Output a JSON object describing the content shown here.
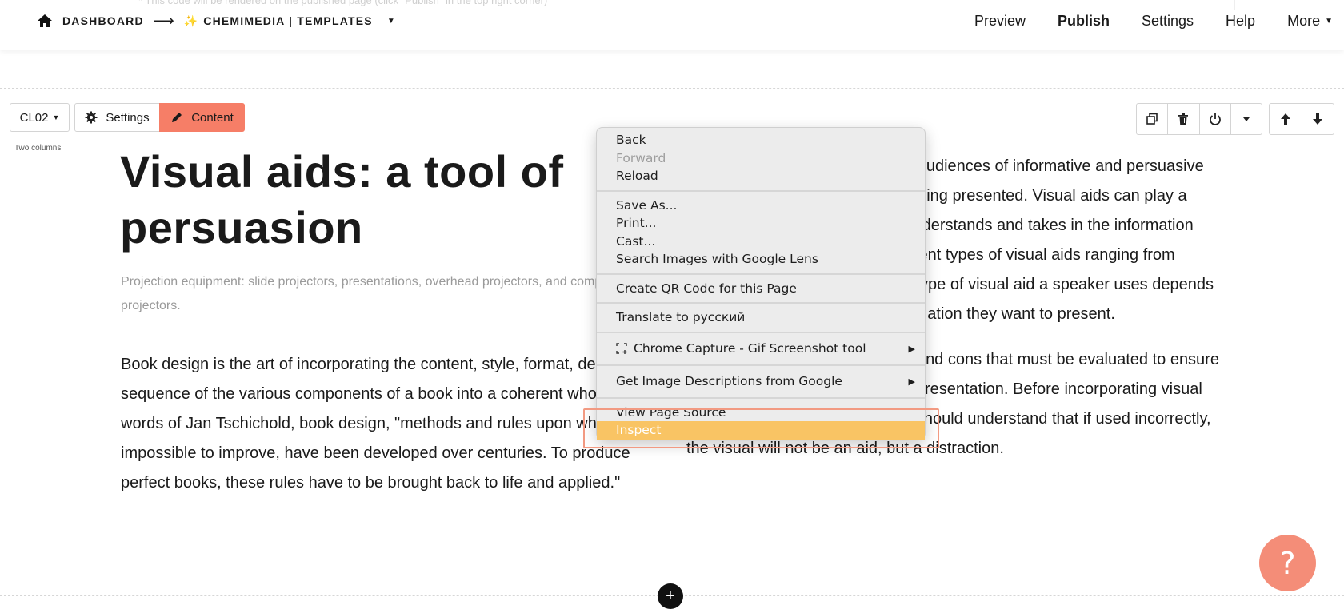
{
  "header": {
    "notice": "* This code will be rendered on the published page (click \"Publish\" in the top right corner)",
    "breadcrumb": {
      "home_icon": "home-icon",
      "dashboard": "DASHBOARD",
      "arrow": "⟶",
      "sparkle": "✨",
      "project": "CHEMIMEDIA | TEMPLATES",
      "caret": "▼"
    },
    "nav": {
      "preview": "Preview",
      "publish": "Publish",
      "settings": "Settings",
      "help": "Help",
      "more": "More"
    }
  },
  "toolbar": {
    "layout_select": "CL02",
    "settings_label": "Settings",
    "content_label": "Content",
    "layout_caption": "Two columns",
    "right_icons": [
      "duplicate-icon",
      "trash-icon",
      "power-icon",
      "caret-down-icon",
      "arrow-up-icon",
      "arrow-down-icon"
    ]
  },
  "content": {
    "title": "Visual aids: a tool of persuasion",
    "caption": "Projection equipment: slide projectors, presentations, overhead projectors, and computer projectors.",
    "left_body": "Book design is the art of incorporating the content, style, format, design, and sequence of the various components of a book into a coherent whole. In the words of Jan Tschichold, book design, \"methods and rules upon which it is impossible to improve, have been developed over centuries. To produce perfect books, these rules have to be brought back to life and applied.\"",
    "right_body_1": "Visual aids are designed to help audiences of informative and persuasive speeches understand the topic being presented. Visual aids can play a large role in how the audience understands and takes in the information presented. There are many different types of visual aids ranging from handouts to presenataions. The type of visual aid a speaker uses depends on their preference and the information they want to present.",
    "right_body_2": "Each type of visual aid has pros and cons that must be evaluated to ensure it will be beneficial to the overall presentation. Before incorporating visual aids into speeches, the speaker should understand that if used incorrectly, the visual will not be an aid, but a distraction."
  },
  "context_menu": {
    "back": "Back",
    "forward": "Forward",
    "reload": "Reload",
    "save_as": "Save As...",
    "print": "Print...",
    "cast": "Cast...",
    "search_lens": "Search Images with Google Lens",
    "qr_code": "Create QR Code for this Page",
    "translate": "Translate to русский",
    "chrome_capture": "Chrome Capture - Gif  Screenshot tool",
    "image_descriptions": "Get Image Descriptions from Google",
    "view_source": "View Page Source",
    "inspect": "Inspect",
    "submenu_arrow": "▶"
  },
  "footer": {
    "add_section": "+",
    "help_fab": "?"
  },
  "colors": {
    "accent": "#f67e67",
    "menu_highlight": "#f9c464",
    "highlight_box": "#f29a82",
    "help_fab": "#f48d78"
  }
}
